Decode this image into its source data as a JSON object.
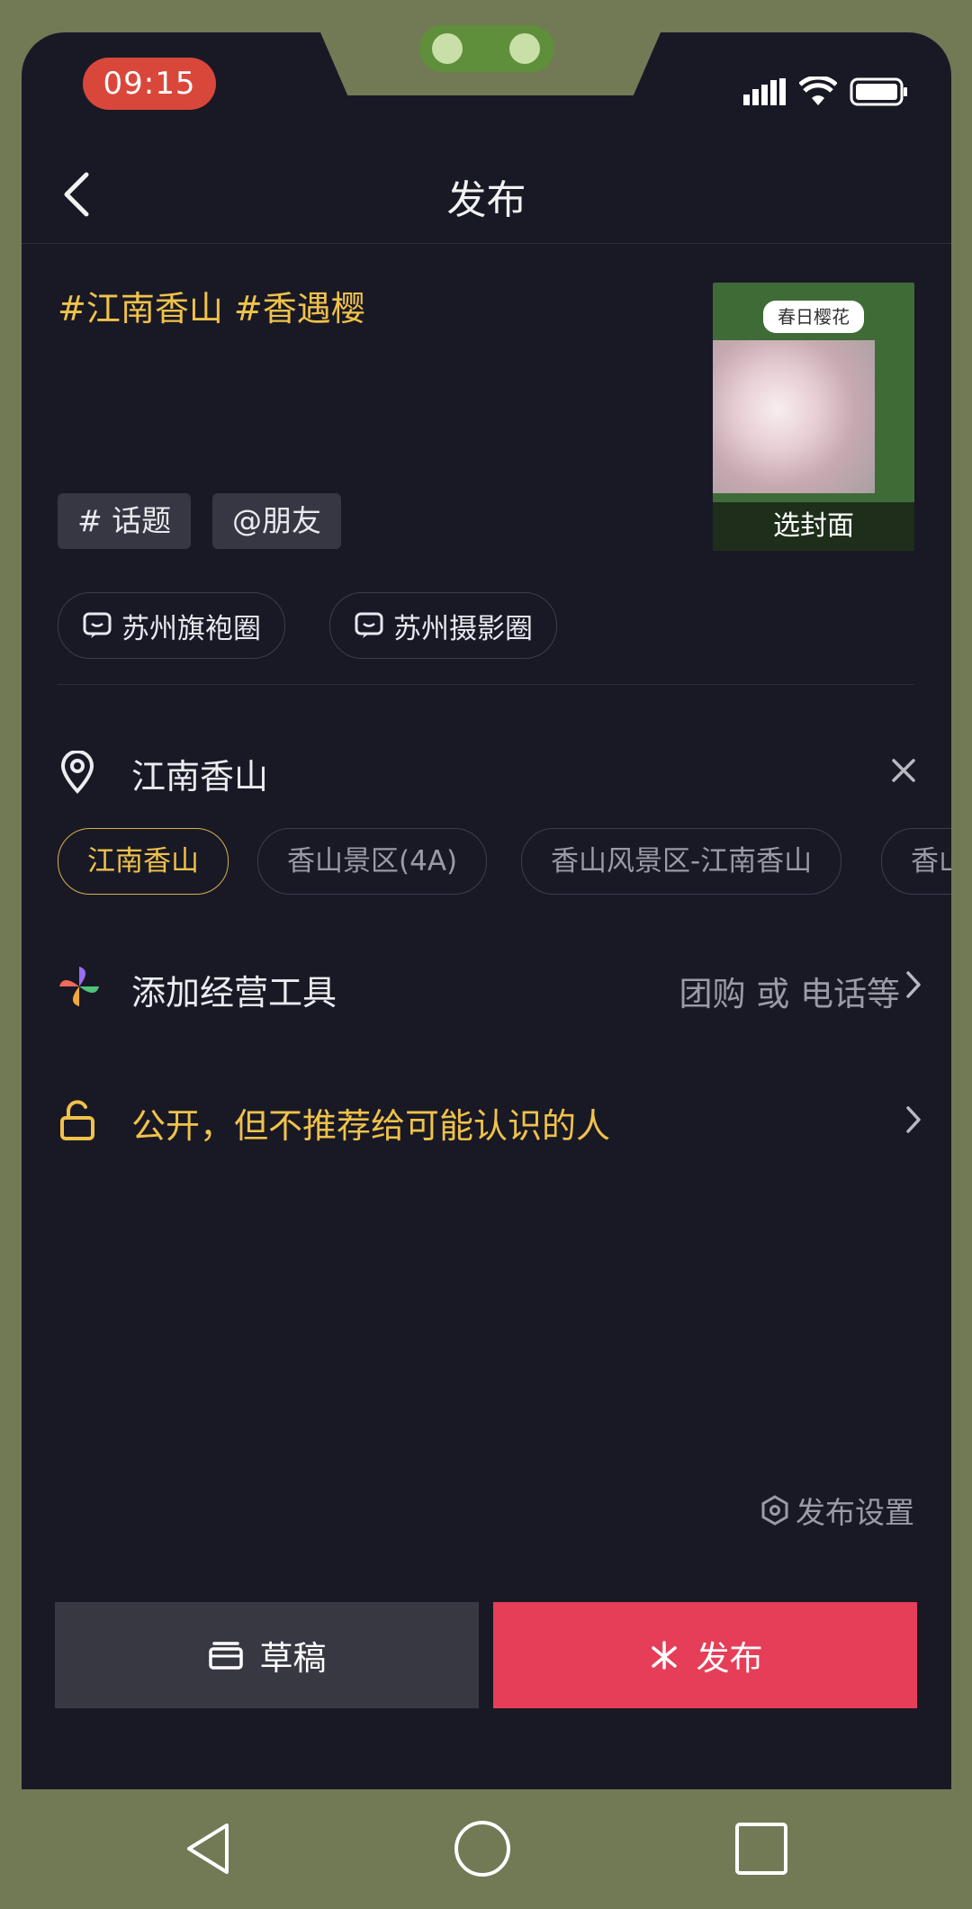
{
  "status_bar": {
    "time": "09:15",
    "icons": [
      "cell-signal-icon",
      "wifi-icon",
      "battery-icon"
    ]
  },
  "header": {
    "back_icon": "chevron-left-icon",
    "title": "发布"
  },
  "post": {
    "hashtags_text": "#江南香山 #香遇樱",
    "chips": {
      "topic": "# 话题",
      "friend": "@朋友"
    },
    "cover": {
      "title": "春日樱花",
      "label": "选封面"
    },
    "circles": [
      "苏州旗袍圈",
      "苏州摄影圈"
    ]
  },
  "location": {
    "value": "江南香山",
    "suggestions": [
      {
        "label": "江南香山",
        "selected": true
      },
      {
        "label": "香山景区(4A)",
        "selected": false
      },
      {
        "label": "香山风景区-江南香山",
        "selected": false
      },
      {
        "label": "香山",
        "selected": false
      }
    ]
  },
  "business_tools": {
    "label": "添加经营工具",
    "hint": "团购 或 电话等"
  },
  "privacy": {
    "label": "公开，但不推荐给可能认识的人"
  },
  "settings_link": "发布设置",
  "actions": {
    "draft": "草稿",
    "publish": "发布"
  },
  "colors": {
    "background": "#191926",
    "accent_yellow": "#f0c24a",
    "publish_red": "#e63e58",
    "status_pill_red": "#d9473b",
    "frame_green": "#717a55"
  }
}
